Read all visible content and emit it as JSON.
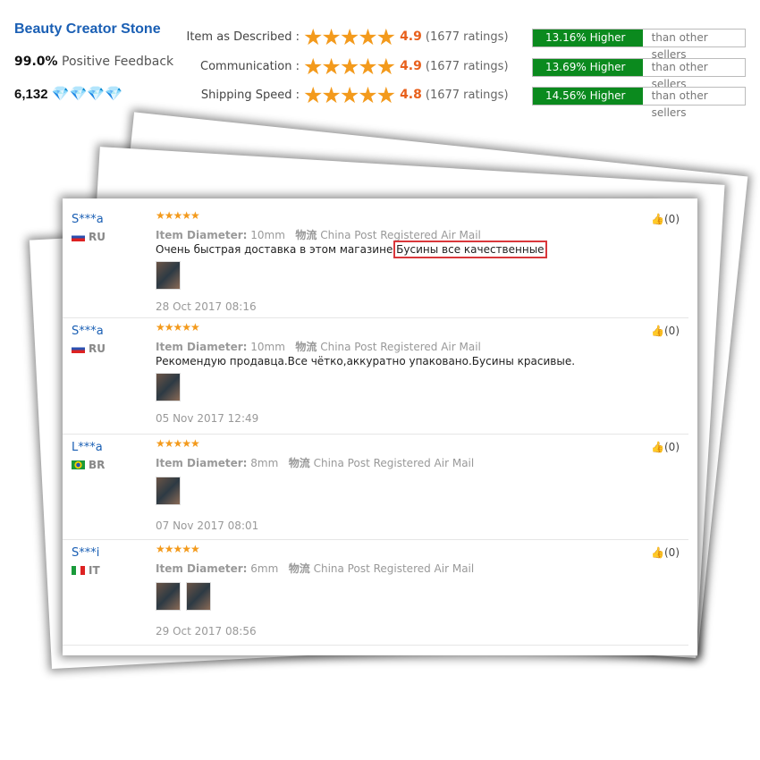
{
  "store": {
    "name": "Beauty Creator Stone",
    "positive_pct": "99.0%",
    "positive_label": "Positive Feedback",
    "score": "6,132",
    "diamond_icon": "diamond-icon",
    "diamonds": 4
  },
  "ratings": [
    {
      "label": "Item as Described :",
      "value": "4.9",
      "count": "(1677 ratings)",
      "pct": "13.16% Higher",
      "cmp": "than other sellers"
    },
    {
      "label": "Communication :",
      "value": "4.9",
      "count": "(1677 ratings)",
      "pct": "13.69% Higher",
      "cmp": "than other sellers"
    },
    {
      "label": "Shipping Speed :",
      "value": "4.8",
      "count": "(1677 ratings)",
      "pct": "14.56% Higher",
      "cmp": "than other sellers"
    }
  ],
  "colors": {
    "accent": "#1a5fb4",
    "star": "#f39a1c",
    "higher": "#0b8a1e",
    "highlight": "#d9373b"
  },
  "reviews": [
    {
      "user": "S***a",
      "country": "RU",
      "attr_label": "Item Diameter:",
      "attr_value": "10mm",
      "ship_label": "物流",
      "ship": "China Post Registered Air Mail",
      "text": "Очень быстрая доставка в этом магазине ",
      "highlight": "Бусины все качественные",
      "date": "28 Oct 2017 08:16",
      "likes": "(0)",
      "photos": 1
    },
    {
      "user": "S***a",
      "country": "RU",
      "attr_label": "Item Diameter:",
      "attr_value": "10mm",
      "ship_label": "物流",
      "ship": "China Post Registered Air Mail",
      "text": "Рекомендую продавца.Все чётко,аккуратно упаковано.Бусины красивые.",
      "highlight": "",
      "date": "05 Nov 2017 12:49",
      "likes": "(0)",
      "photos": 1
    },
    {
      "user": "L***a",
      "country": "BR",
      "attr_label": "Item Diameter:",
      "attr_value": "8mm",
      "ship_label": "物流",
      "ship": "China Post Registered Air Mail",
      "text": "",
      "highlight": "",
      "date": "07 Nov 2017 08:01",
      "likes": "(0)",
      "photos": 1
    },
    {
      "user": "S***i",
      "country": "IT",
      "attr_label": "Item Diameter:",
      "attr_value": "6mm",
      "ship_label": "物流",
      "ship": "China Post Registered Air Mail",
      "text": "",
      "highlight": "",
      "date": "29 Oct 2017 08:56",
      "likes": "(0)",
      "photos": 2
    }
  ]
}
